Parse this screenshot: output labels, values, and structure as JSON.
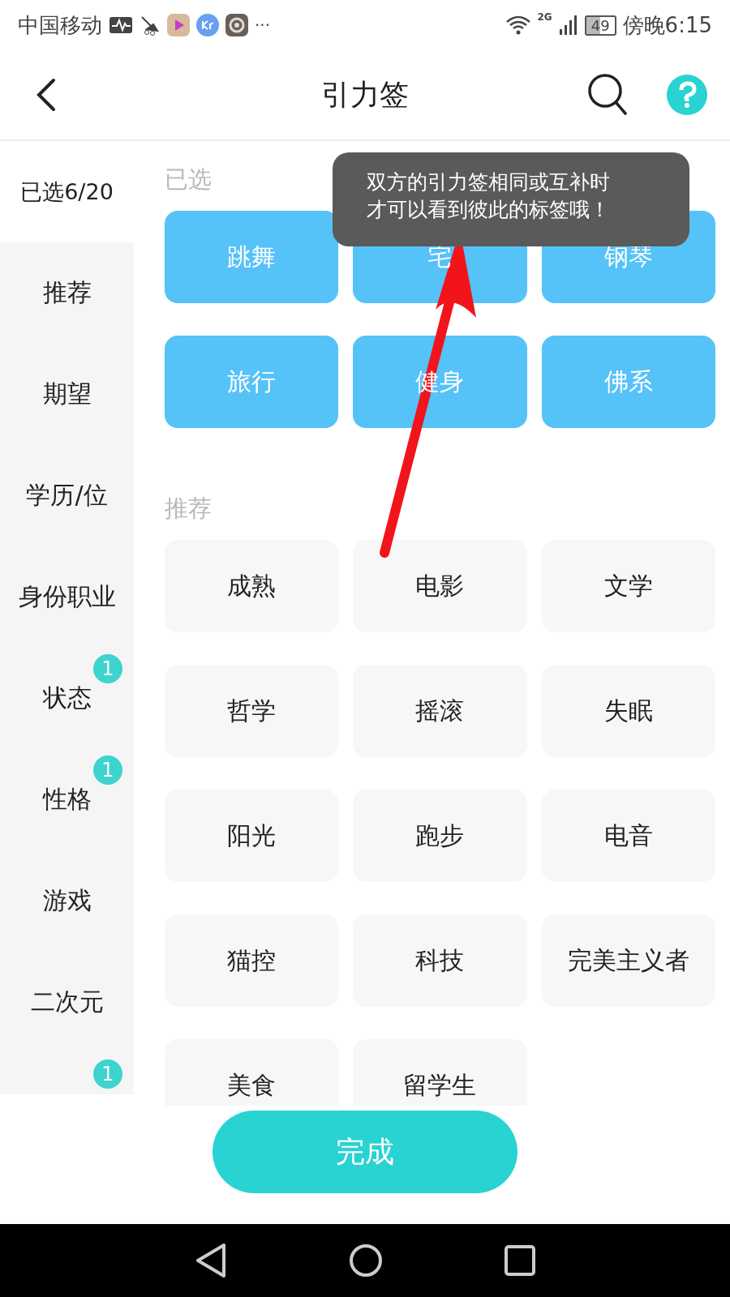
{
  "status_bar": {
    "carrier": "中国移动",
    "more": "···",
    "network": "2G",
    "battery": "49",
    "time": "傍晚6:15"
  },
  "header": {
    "title": "引力签"
  },
  "sidebar": {
    "items": [
      {
        "label": "已选6/20",
        "selected": true
      },
      {
        "label": "推荐",
        "selected": false
      },
      {
        "label": "期望",
        "selected": false
      },
      {
        "label": "学历/位",
        "selected": false
      },
      {
        "label": "身份职业",
        "selected": false
      },
      {
        "label": "状态",
        "selected": false,
        "badge": "1"
      },
      {
        "label": "性格",
        "selected": false,
        "badge": "1"
      },
      {
        "label": "游戏",
        "selected": false
      },
      {
        "label": "二次元",
        "selected": false
      },
      {
        "badge": "1"
      }
    ]
  },
  "sections": [
    {
      "heading": "已选",
      "tags": [
        {
          "label": "跳舞",
          "selected": true
        },
        {
          "label": "宅",
          "selected": true
        },
        {
          "label": "钢琴",
          "selected": true
        },
        {
          "label": "旅行",
          "selected": true
        },
        {
          "label": "健身",
          "selected": true
        },
        {
          "label": "佛系",
          "selected": true
        }
      ]
    },
    {
      "heading": "推荐",
      "tags": [
        {
          "label": "成熟",
          "selected": false
        },
        {
          "label": "电影",
          "selected": false
        },
        {
          "label": "文学",
          "selected": false
        },
        {
          "label": "哲学",
          "selected": false
        },
        {
          "label": "摇滚",
          "selected": false
        },
        {
          "label": "失眠",
          "selected": false
        },
        {
          "label": "阳光",
          "selected": false
        },
        {
          "label": "跑步",
          "selected": false
        },
        {
          "label": "电音",
          "selected": false
        },
        {
          "label": "猫控",
          "selected": false
        },
        {
          "label": "科技",
          "selected": false
        },
        {
          "label": "完美主义者",
          "selected": false
        },
        {
          "label": "美食",
          "selected": false
        },
        {
          "label": "留学生",
          "selected": false
        }
      ]
    }
  ],
  "tooltip": {
    "lines": [
      "双方的引力签相同或互补时",
      "才可以看到彼此的标签哦！"
    ]
  },
  "done_button": "完成"
}
